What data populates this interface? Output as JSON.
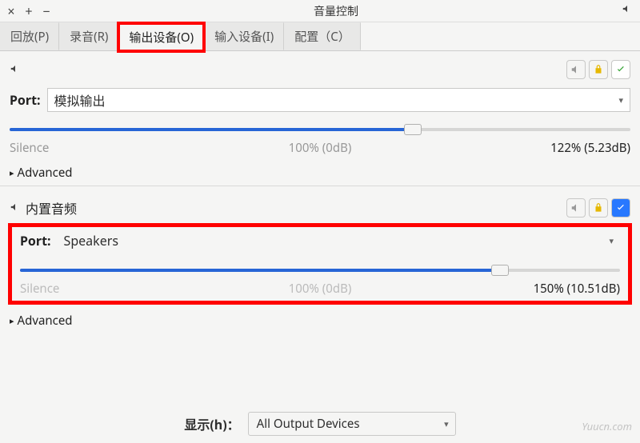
{
  "window": {
    "title": "音量控制"
  },
  "tabs": {
    "playback": "回放(P)",
    "recording": "录音(R)",
    "output": "输出设备(O)",
    "input": "输入设备(I)",
    "config": "配置（C）"
  },
  "device1": {
    "title": "",
    "port_label": "Port:",
    "port_value": "模拟输出",
    "silence_label": "Silence",
    "center_label": "100% (0dB)",
    "value_label": "122% (5.23dB)",
    "advanced": "Advanced",
    "fill_percent": 65
  },
  "device2": {
    "title": "内置音频",
    "port_label": "Port:",
    "port_value": "Speakers",
    "silence_label": "Silence",
    "center_label": "100% (0dB)",
    "value_label": "150% (10.51dB)",
    "advanced": "Advanced",
    "fill_percent": 80
  },
  "bottom": {
    "label": "显示(h)：",
    "value": "All Output Devices"
  },
  "watermark": "Yuucn.com"
}
